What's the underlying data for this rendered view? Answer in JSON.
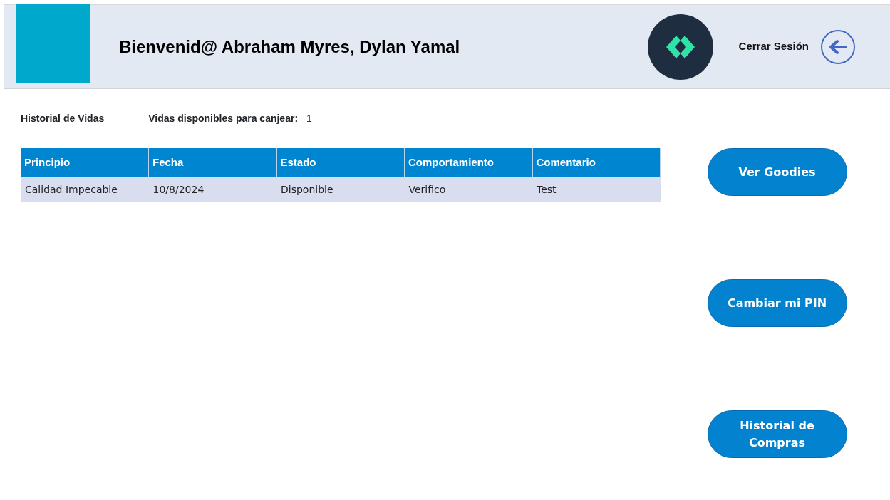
{
  "header": {
    "welcome": "Bienvenid@ Abraham Myres, Dylan Yamal",
    "logout_label": "Cerrar Sesión"
  },
  "summary": {
    "title": "Historial de Vidas",
    "available_label": "Vidas disponibles para canjear:",
    "available_count": "1"
  },
  "table": {
    "columns": [
      "Principio",
      "Fecha",
      "Estado",
      "Comportamiento",
      "Comentario"
    ],
    "rows": [
      [
        "Calidad Impecable",
        "10/8/2024",
        "Disponible",
        "Verifico",
        "Test"
      ]
    ]
  },
  "actions": [
    {
      "label": "Ver Goodies"
    },
    {
      "label": "Cambiar mi PIN"
    },
    {
      "label": "Historial de Compras"
    }
  ]
}
